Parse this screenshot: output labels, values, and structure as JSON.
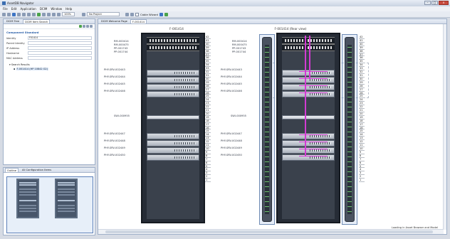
{
  "window": {
    "title": "AssetDB Navigator"
  },
  "menu": [
    "File",
    "Edit",
    "Application",
    "DCIM",
    "Window",
    "Help"
  ],
  "toolbar": {
    "zoom": "100%",
    "project": "No Project",
    "cable_wizard_label": "Cable Wizard"
  },
  "left_panel": {
    "tabs": [
      "DCIM Tree",
      "DCIM Item Search"
    ],
    "section": "Component Standard",
    "fields": [
      {
        "label": "Identity",
        "value": "F01414"
      },
      {
        "label": "Parent Identity",
        "value": ""
      },
      {
        "label": "IP Address",
        "value": ""
      },
      {
        "label": "Hostname",
        "value": ""
      },
      {
        "label": "MAC Address",
        "value": ""
      }
    ],
    "tree": {
      "root": "Search Results",
      "child": "F-001414 (HP 10842 G2)"
    }
  },
  "outline_panel": {
    "tabs": [
      "Outline",
      "All Configuration Items"
    ]
  },
  "editor": {
    "tabs": [
      "DCIM Welcome Page",
      "F-001414"
    ],
    "rack_left_title": "F-001414",
    "rack_right_title": "F-001414 (Rear view)",
    "units": [
      "42",
      "41",
      "40",
      "39",
      "38",
      "37",
      "36",
      "35",
      "34",
      "33",
      "32",
      "31",
      "30",
      "29",
      "28",
      "27",
      "26",
      "25",
      "24",
      "23",
      "22",
      "21",
      "20",
      "19",
      "18",
      "17",
      "16",
      "15",
      "14",
      "13",
      "12",
      "11",
      "10",
      "9",
      "8",
      "7",
      "6",
      "5",
      "4",
      "3",
      "2",
      "1"
    ],
    "devices": [
      {
        "label": "RM-000414",
        "unit": 42
      },
      {
        "label": "RM-000475",
        "unit": 41
      },
      {
        "label": "PP-001743",
        "unit": 40
      },
      {
        "label": "PP-001744",
        "unit": 39
      },
      {
        "label": "PHY-SRV-002443",
        "unit": 36
      },
      {
        "label": "PHY-SRV-002444",
        "unit": 34
      },
      {
        "label": "PHY-SRV-002445",
        "unit": 32
      },
      {
        "label": "PHY-SRV-002446",
        "unit": 30
      },
      {
        "label": "SWI-000955",
        "unit": 26
      },
      {
        "label": "PHY-SRV-002447",
        "unit": 22
      },
      {
        "label": "PHY-SRV-002448",
        "unit": 20
      },
      {
        "label": "PHY-SRV-002449",
        "unit": 18
      },
      {
        "label": "PHY-SRV-002450",
        "unit": 16
      }
    ],
    "status": "Loading in Asset Browser and Model"
  },
  "colors": {
    "cable": "#d23bd2",
    "rack": "#262c36",
    "pdu_led": "#6bc26b",
    "accent": "#3a6db0"
  }
}
